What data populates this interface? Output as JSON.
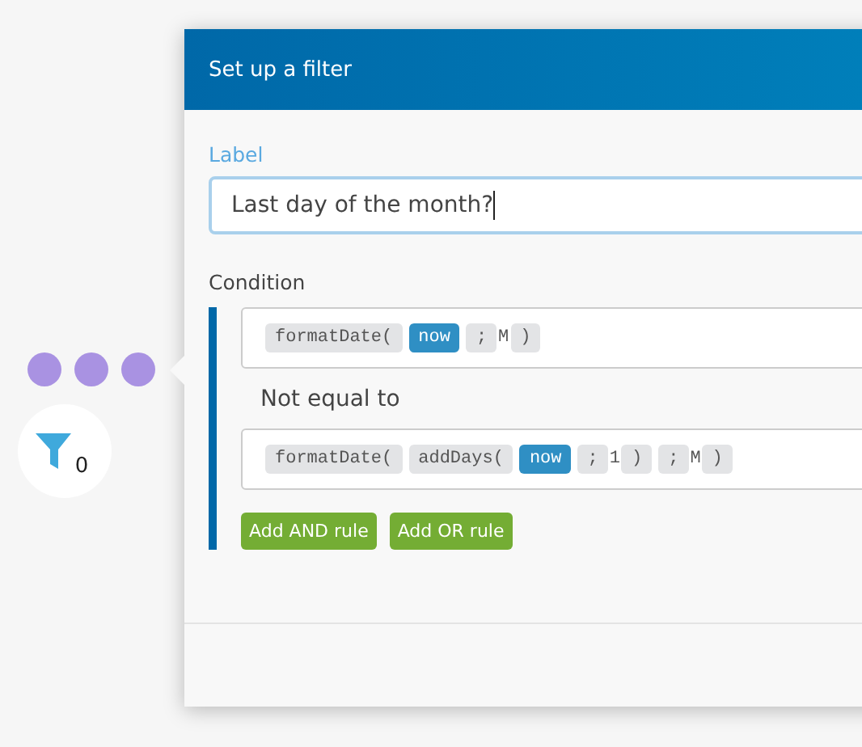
{
  "node": {
    "dots": [
      {
        "color": "#a992e2"
      },
      {
        "color": "#a992e2"
      },
      {
        "color": "#a992e2"
      }
    ],
    "filter_count": "0"
  },
  "dialog": {
    "title": "Set up a filter",
    "label_field": {
      "label": "Label",
      "value": "Last day of the month?",
      "focused": true
    },
    "condition": {
      "label": "Condition",
      "operand_1": [
        {
          "kind": "func",
          "text": "formatDate("
        },
        {
          "kind": "var",
          "text": "now"
        },
        {
          "kind": "sep",
          "text": ";"
        },
        {
          "kind": "plain",
          "text": "M"
        },
        {
          "kind": "sep",
          "text": ")"
        }
      ],
      "operator": "Not equal to",
      "operand_2": [
        {
          "kind": "func",
          "text": "formatDate("
        },
        {
          "kind": "func",
          "text": "addDays("
        },
        {
          "kind": "var",
          "text": "now"
        },
        {
          "kind": "sep",
          "text": ";"
        },
        {
          "kind": "plain",
          "text": "1"
        },
        {
          "kind": "sep",
          "text": ")"
        },
        {
          "kind": "sep",
          "text": ";"
        },
        {
          "kind": "plain",
          "text": "M"
        },
        {
          "kind": "sep",
          "text": ")"
        }
      ]
    },
    "buttons": [
      "Add AND rule",
      "Add OR rule"
    ]
  }
}
